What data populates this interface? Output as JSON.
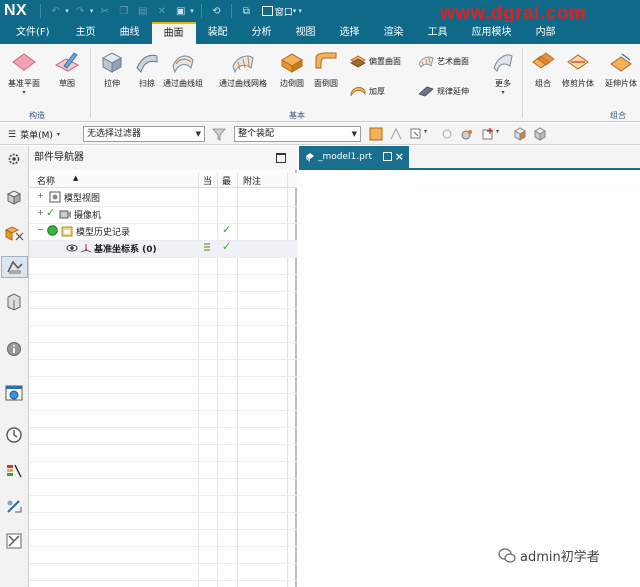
{
  "app": {
    "logo": "NX",
    "window_menu": "窗口",
    "watermark": "www.dgrai.com"
  },
  "menu": {
    "tabs": [
      {
        "label": "文件(F)"
      },
      {
        "label": "主页"
      },
      {
        "label": "曲线"
      },
      {
        "label": "曲面"
      },
      {
        "label": "装配"
      },
      {
        "label": "分析"
      },
      {
        "label": "视图"
      },
      {
        "label": "选择"
      },
      {
        "label": "渲染"
      },
      {
        "label": "工具"
      },
      {
        "label": "应用模块"
      },
      {
        "label": "内部"
      }
    ],
    "active_tab": "曲面"
  },
  "ribbon": {
    "buttons": {
      "basic_plane": "基准平面",
      "sketch": "草图",
      "extrude": "拉伸",
      "sweep": "扫掠",
      "through_curves": "通过曲线组",
      "through_curve_mesh": "通过曲线网格",
      "sided_surface": "边倒圆",
      "face_blend": "面倒圆",
      "offset_surface": "偏置曲面",
      "thicken": "加厚",
      "studio_surface": "艺术曲面",
      "law_extension": "规律延伸",
      "more": "更多",
      "combine": "组合",
      "trim_sheet": "修剪片体",
      "extend_sheet": "延伸片体"
    },
    "groups": {
      "construct": "构造",
      "basic": "基本",
      "combine": "组合"
    }
  },
  "filterbar": {
    "menu_label": "菜单(M)",
    "selection_filter": "无选择过滤器",
    "scope": "整个装配"
  },
  "navigator": {
    "title": "部件导航器",
    "columns": {
      "name": "名称",
      "current": "当",
      "latest": "最",
      "notes": "附注"
    },
    "rows": [
      {
        "label": "模型视图"
      },
      {
        "label": "摄像机"
      },
      {
        "label": "模型历史记录"
      },
      {
        "label": "基准坐标系 (0)"
      }
    ]
  },
  "graphics": {
    "tab_label": "_model1.prt"
  },
  "footer": {
    "wechat_label": "admin初学者"
  },
  "colors": {
    "titlebar": "#0f6a89",
    "active_tab_accent": "#f0b400",
    "watermark": "#e02020",
    "check": "#3aa63a"
  }
}
